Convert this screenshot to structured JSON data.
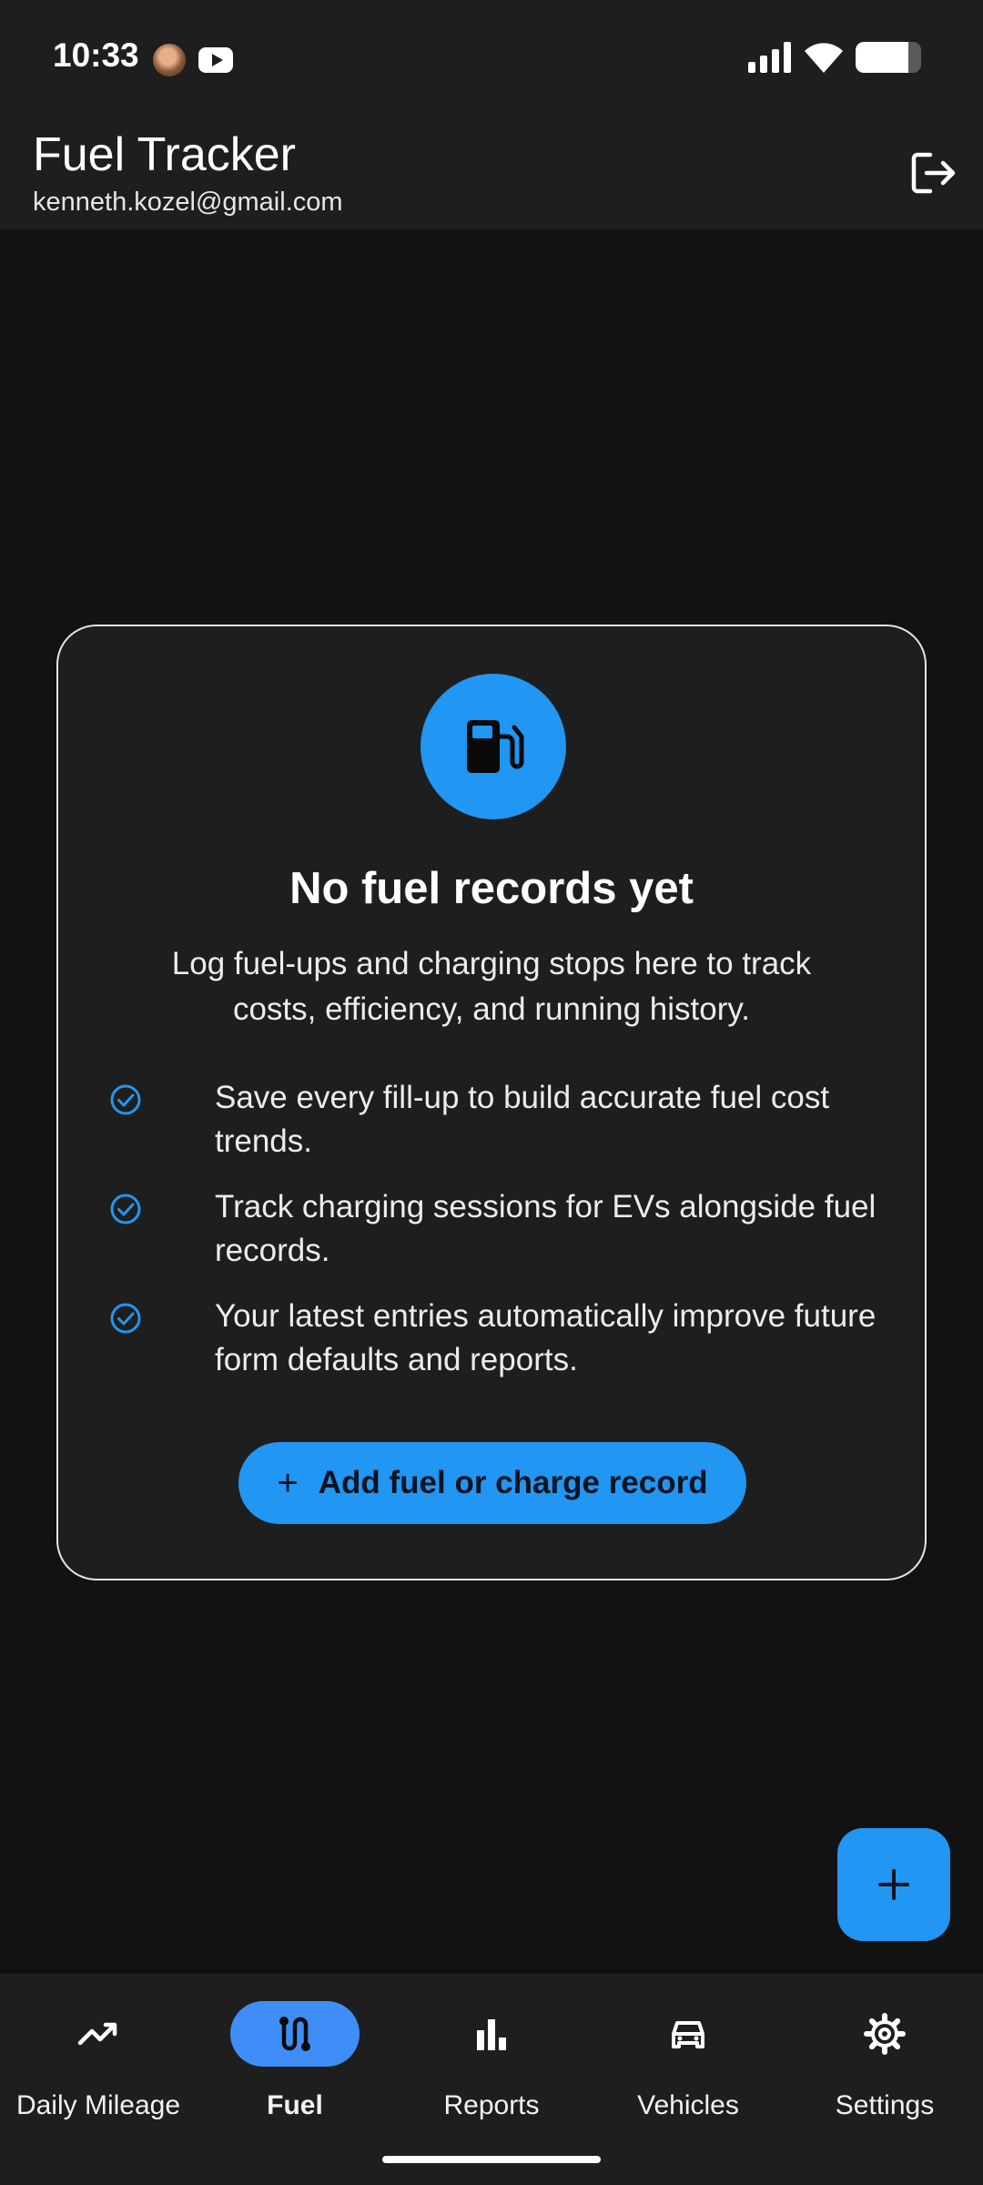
{
  "status_bar": {
    "time": "10:33",
    "battery_level": 0.8
  },
  "app_bar": {
    "title": "Fuel Tracker",
    "subtitle": "kenneth.kozel@gmail.com",
    "logout_icon": "logout-icon"
  },
  "empty_state": {
    "icon": "fuel-pump-icon",
    "title": "No fuel records yet",
    "description": "Log fuel-ups and charging stops here to track costs, efficiency, and running history.",
    "benefits": [
      "Save every fill-up to build accurate fuel cost trends.",
      "Track charging sessions for EVs alongside fuel records.",
      "Your latest entries automatically improve future form defaults and reports."
    ],
    "cta_label": "Add fuel or charge record"
  },
  "fab": {
    "icon": "plus-icon"
  },
  "bottom_nav": {
    "items": [
      {
        "label": "Daily Mileage",
        "icon": "trending-up-icon",
        "active": false
      },
      {
        "label": "Fuel",
        "icon": "route-icon",
        "active": true
      },
      {
        "label": "Reports",
        "icon": "bar-chart-icon",
        "active": false
      },
      {
        "label": "Vehicles",
        "icon": "car-icon",
        "active": false
      },
      {
        "label": "Settings",
        "icon": "gear-icon",
        "active": false
      }
    ]
  },
  "colors": {
    "accent": "#2196f3",
    "nav_active": "#3f8ef7",
    "surface": "#1e1e1e",
    "background": "#121212"
  }
}
